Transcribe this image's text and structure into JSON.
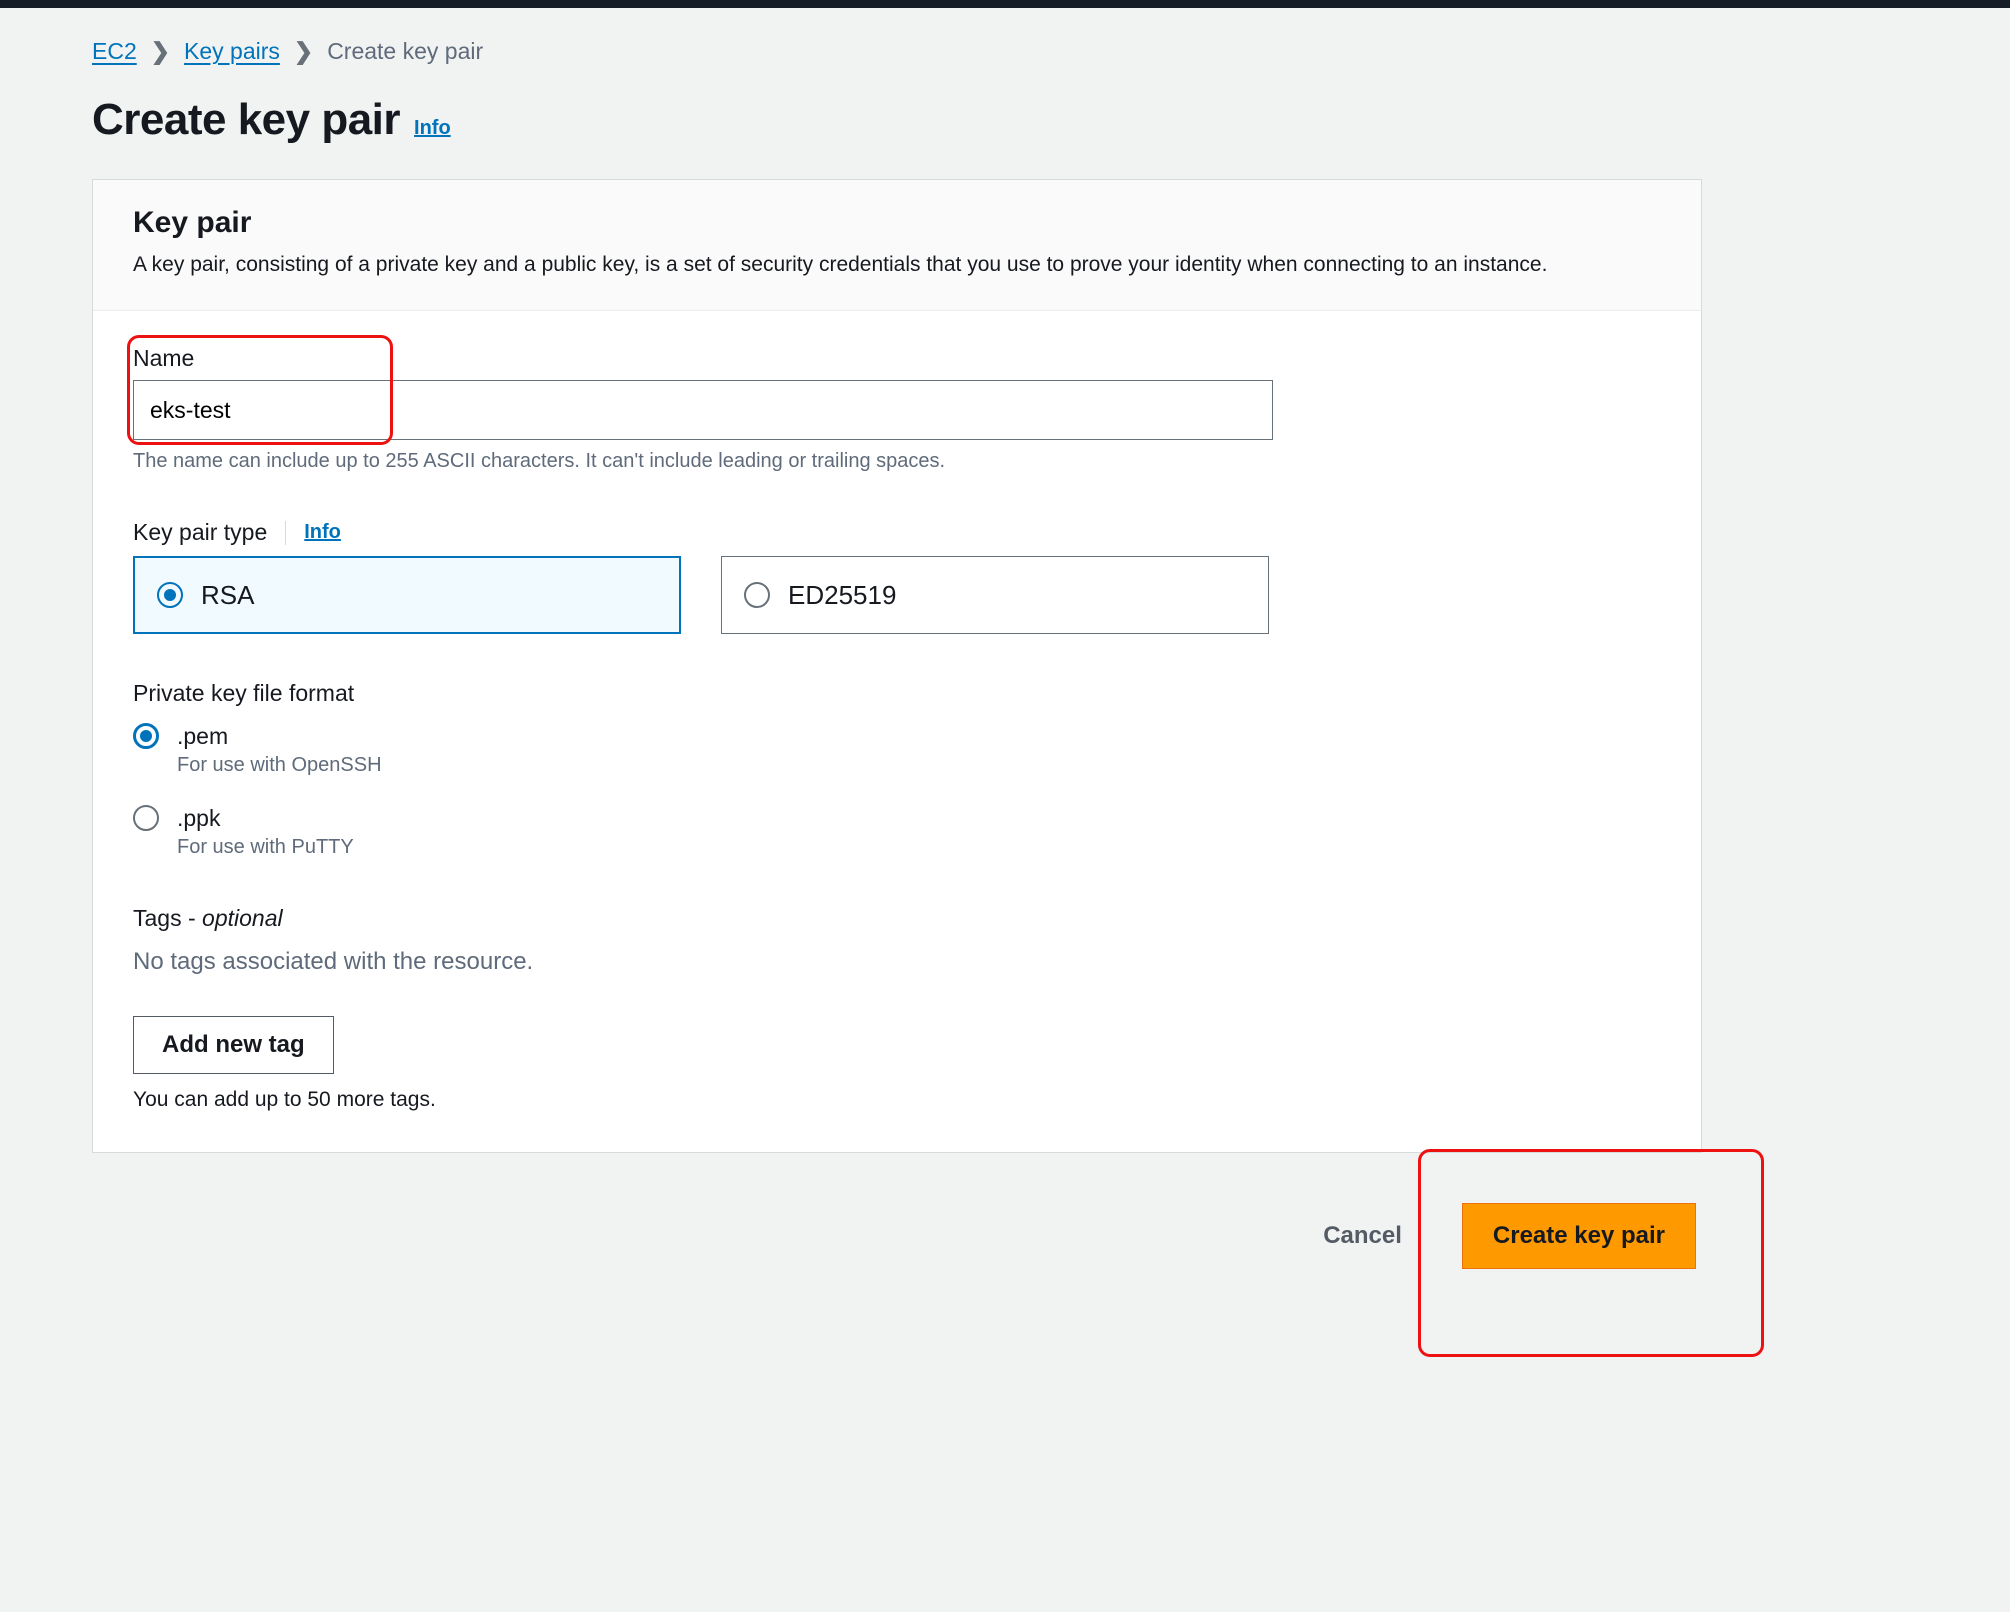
{
  "breadcrumb": {
    "items": [
      "EC2",
      "Key pairs",
      "Create key pair"
    ]
  },
  "heading": {
    "title": "Create key pair",
    "info": "Info"
  },
  "panel": {
    "title": "Key pair",
    "description": "A key pair, consisting of a private key and a public key, is a set of security credentials that you use to prove your identity when connecting to an instance."
  },
  "name": {
    "label": "Name",
    "value": "eks-test",
    "hint": "The name can include up to 255 ASCII characters. It can't include leading or trailing spaces."
  },
  "type": {
    "label": "Key pair type",
    "info": "Info",
    "options": [
      "RSA",
      "ED25519"
    ],
    "selected": "RSA"
  },
  "format": {
    "label": "Private key file format",
    "options": [
      {
        "value": ".pem",
        "sub": "For use with OpenSSH"
      },
      {
        "value": ".ppk",
        "sub": "For use with PuTTY"
      }
    ],
    "selected": ".pem"
  },
  "tags": {
    "label": "Tags - ",
    "optional": "optional",
    "empty": "No tags associated with the resource.",
    "add": "Add new tag",
    "hint": "You can add up to 50 more tags."
  },
  "footer": {
    "cancel": "Cancel",
    "submit": "Create key pair"
  }
}
